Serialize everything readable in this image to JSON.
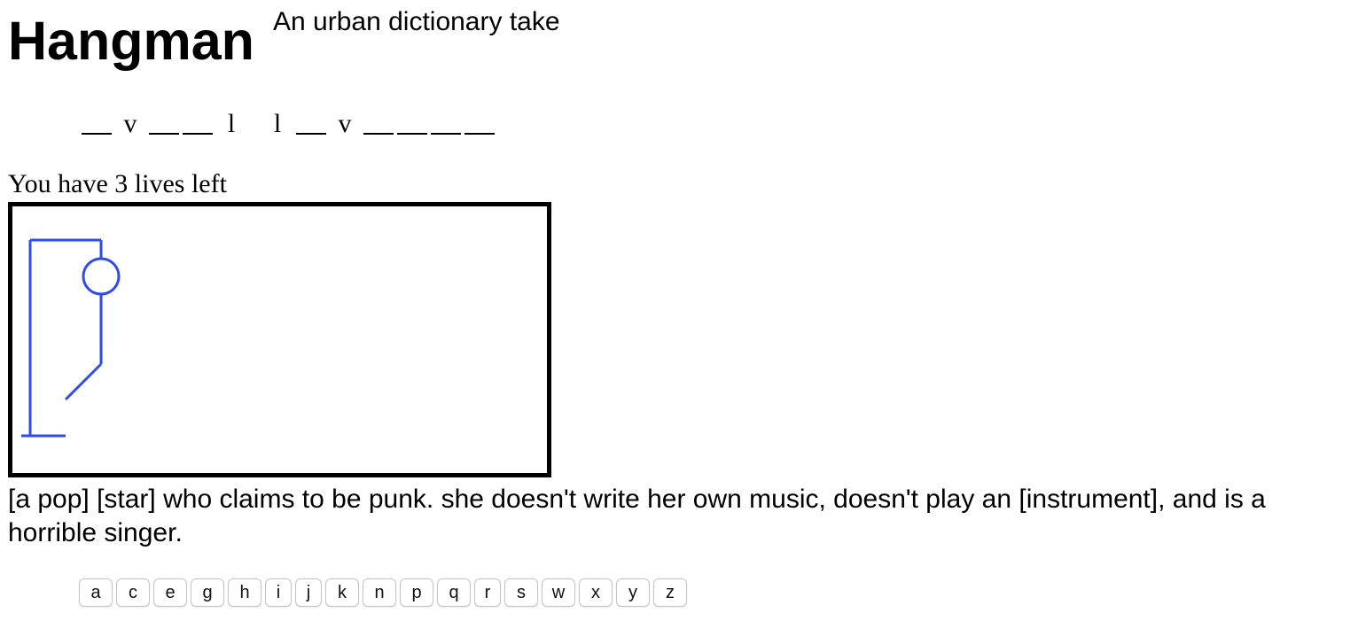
{
  "header": {
    "title": "Hangman",
    "subtitle": "An urban dictionary take"
  },
  "word": {
    "words": [
      [
        "",
        "v",
        "",
        "",
        "l"
      ],
      [
        "l",
        "",
        "v",
        "",
        "",
        "",
        ""
      ]
    ]
  },
  "status": {
    "lives_text": "You have 3 lives left",
    "lives_remaining": 3
  },
  "drawing": {
    "color": "#2f4bef",
    "parts_shown": [
      "base",
      "pole",
      "beam",
      "rope",
      "head",
      "body",
      "left-leg"
    ]
  },
  "definition": {
    "text": "[a pop] [star] who claims to be punk. she doesn't write her own music, doesn't play an [instrument], and is a horrible singer."
  },
  "keyboard": {
    "keys": [
      "a",
      "c",
      "e",
      "g",
      "h",
      "i",
      "j",
      "k",
      "n",
      "p",
      "q",
      "r",
      "s",
      "w",
      "x",
      "y",
      "z"
    ]
  }
}
